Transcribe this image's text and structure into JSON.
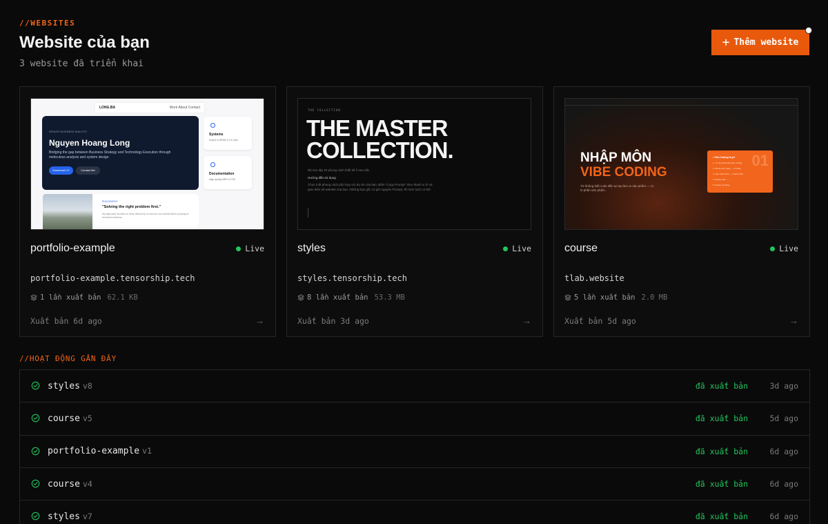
{
  "header": {
    "section_label": "//WEBSITES",
    "title": "Website của bạn",
    "subtitle": "3 website đã triển khai",
    "add_button_label": "Thêm website",
    "accent_color": "#e8590c"
  },
  "websites": [
    {
      "name": "portfolio-example",
      "status": "Live",
      "domain": "portfolio-example.tensorship.tech",
      "publish_count": "1 lần xuất bản",
      "size": "62.1 KB",
      "published": "Xuất bản 6d ago",
      "preview": {
        "brand": "LONG.BA",
        "nav_links": "Work   About   Contact",
        "kicker": "SENIOR BUSINESS ANALYST",
        "hero_name": "Nguyen Hoang Long",
        "hero_desc": "Bridging the gap between Business Strategy and Technology Execution through meticulous analysis and system design.",
        "btn_primary": "Download CV",
        "btn_secondary": "Contact Me",
        "card1_title": "Systems",
        "card1_desc": "Expert in BPMN 2.0 & UML",
        "card2_title": "Documentation",
        "card2_desc": "High-quality BRD & FSD",
        "quote_kicker": "PHILOSOPHY",
        "quote_title": "\"Solving the right problem first.\"",
        "quote_desc": "My approach focuses on deep discovery to uncover root needs before jumping to technical solutions."
      }
    },
    {
      "name": "styles",
      "status": "Live",
      "domain": "styles.tensorship.tech",
      "publish_count": "8 lần xuất bản",
      "size": "53.3 MB",
      "published": "Xuất bản 3d ago",
      "preview": {
        "kicker": "THE COLLECTION",
        "headline_1": "THE MASTER",
        "headline_2": "COLLECTION.",
        "line1": "Bộ sưu tập 20 phong cách thiết kế ô sao sắc.",
        "line2": "Hướng dẫn sử dụng",
        "line3": "Chọn một phong cách phù hợp với dự án của bạn. Bấm \"Copy Prompt\" theo thanh vị trí và giao diện sẽ website của bạn. Những bạn gốc có giữ nguyên Prompt, thì luôn luôn có thể."
      }
    },
    {
      "name": "course",
      "status": "Live",
      "domain": "tlab.website",
      "publish_count": "5 lần xuất bản",
      "size": "2.0 MB",
      "published": "Xuất bản 5d ago",
      "preview": {
        "headline_1": "NHẬP MÔN",
        "headline_2": "VIBE CODING",
        "sub": "Từ không biết code đến tự tay làm ra sản phẩm — AI lo phần sản phẩm.",
        "panel_title": "• Vibe Coding là gì?",
        "panel_items": [
          "1. Tư duy phát triển lấy ý tưởng",
          "2. Mô tả chức năng → AI build",
          "3. Xây nhanh hơn — nhanh nhất",
          "4. Deploy kiến → ...",
          "5. Deploy dễ dàng"
        ],
        "panel_number": "01"
      }
    }
  ],
  "activity": {
    "label": "//HOẠT ĐỘNG GẦN ĐÂY",
    "rows": [
      {
        "name": "styles",
        "version": "v8",
        "status": "đã xuất bản",
        "ago": "3d ago"
      },
      {
        "name": "course",
        "version": "v5",
        "status": "đã xuất bản",
        "ago": "5d ago"
      },
      {
        "name": "portfolio-example",
        "version": "v1",
        "status": "đã xuất bản",
        "ago": "6d ago"
      },
      {
        "name": "course",
        "version": "v4",
        "status": "đã xuất bản",
        "ago": "6d ago"
      },
      {
        "name": "styles",
        "version": "v7",
        "status": "đã xuất bản",
        "ago": "6d ago"
      }
    ]
  },
  "icons": {
    "add": "plus-icon",
    "layers": "layers-icon",
    "arrow": "arrow-right-icon",
    "check": "check-circle-icon",
    "live": "live-dot-icon"
  },
  "colors": {
    "background": "#0a0a0a",
    "accent": "#f26418",
    "success": "#22c55e"
  }
}
